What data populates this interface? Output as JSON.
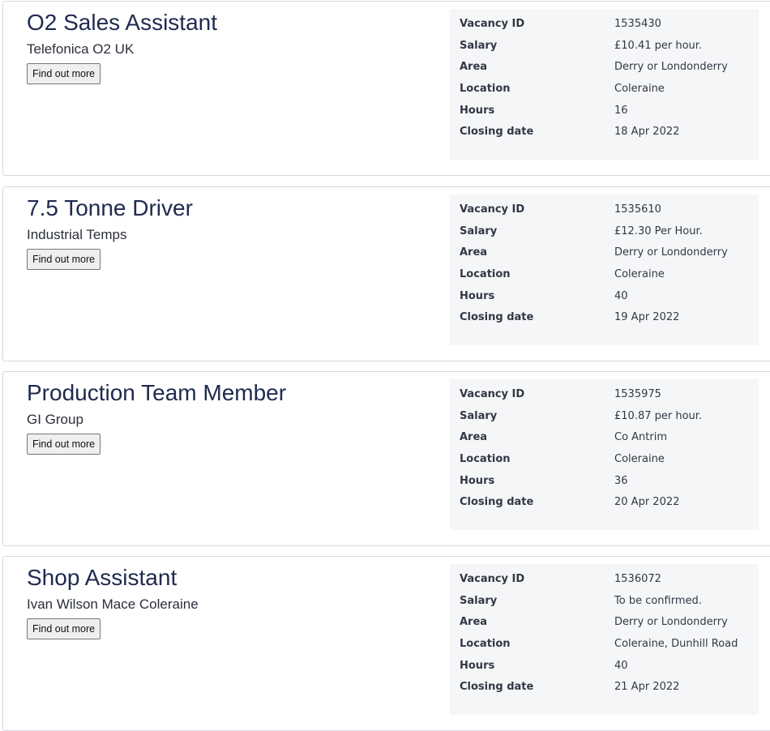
{
  "labels": {
    "vacancy_id": "Vacancy ID",
    "salary": "Salary",
    "area": "Area",
    "location": "Location",
    "hours": "Hours",
    "closing_date": "Closing date",
    "find_out_more": "Find out more"
  },
  "vacancies": [
    {
      "title": "O2 Sales Assistant",
      "employer": "Telefonica O2 UK",
      "vacancy_id": "1535430",
      "salary": "£10.41 per hour.",
      "area": "Derry or Londonderry",
      "location": "Coleraine",
      "hours": "16",
      "closing_date": "18 Apr 2022"
    },
    {
      "title": "7.5 Tonne Driver",
      "employer": "Industrial Temps",
      "vacancy_id": "1535610",
      "salary": "£12.30 Per Hour.",
      "area": "Derry or Londonderry",
      "location": "Coleraine",
      "hours": "40",
      "closing_date": "19 Apr 2022"
    },
    {
      "title": "Production Team Member",
      "employer": "GI Group",
      "vacancy_id": "1535975",
      "salary": "£10.87 per hour.",
      "area": "Co Antrim",
      "location": "Coleraine",
      "hours": "36",
      "closing_date": "20 Apr 2022"
    },
    {
      "title": "Shop Assistant",
      "employer": "Ivan Wilson Mace Coleraine",
      "vacancy_id": "1536072",
      "salary": "To be confirmed.",
      "area": "Derry or Londonderry",
      "location": "Coleraine, Dunhill Road",
      "hours": "40",
      "closing_date": "21 Apr 2022"
    }
  ]
}
